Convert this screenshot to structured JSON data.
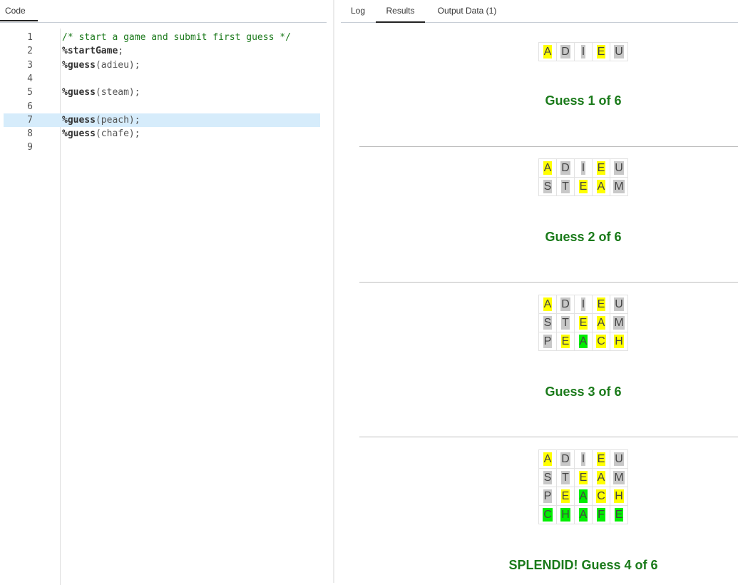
{
  "code_panel": {
    "tab_label": "Code",
    "active_line": 7,
    "lines": [
      {
        "num": "1",
        "comment": "/* start a game and submit first guess */",
        "keyword": "",
        "rest": ""
      },
      {
        "num": "2",
        "comment": "",
        "keyword": "%startGame",
        "rest": ";"
      },
      {
        "num": "3",
        "comment": "",
        "keyword": "%guess",
        "rest": "(adieu);"
      },
      {
        "num": "4",
        "comment": "",
        "keyword": "",
        "rest": ""
      },
      {
        "num": "5",
        "comment": "",
        "keyword": "%guess",
        "rest": "(steam);"
      },
      {
        "num": "6",
        "comment": "",
        "keyword": "",
        "rest": ""
      },
      {
        "num": "7",
        "comment": "",
        "keyword": "%guess",
        "rest": "(peach);"
      },
      {
        "num": "8",
        "comment": "",
        "keyword": "%guess",
        "rest": "(chafe);"
      },
      {
        "num": "9",
        "comment": "",
        "keyword": "",
        "rest": ""
      }
    ]
  },
  "results_panel": {
    "tabs": [
      {
        "label": "Log",
        "active": false
      },
      {
        "label": "Results",
        "active": true
      },
      {
        "label": "Output Data (1)",
        "active": false
      }
    ],
    "colors": {
      "present": "#ffff00",
      "absent": "#c8c8c8",
      "correct": "#00ee00",
      "title": "#1a7a1a"
    },
    "blocks": [
      {
        "title": "Guess 1 of 6",
        "rows": [
          [
            {
              "l": "A",
              "s": "present"
            },
            {
              "l": "D",
              "s": "absent"
            },
            {
              "l": "I",
              "s": "absent"
            },
            {
              "l": "E",
              "s": "present"
            },
            {
              "l": "U",
              "s": "absent"
            }
          ]
        ]
      },
      {
        "title": "Guess 2 of 6",
        "rows": [
          [
            {
              "l": "A",
              "s": "present"
            },
            {
              "l": "D",
              "s": "absent"
            },
            {
              "l": "I",
              "s": "absent"
            },
            {
              "l": "E",
              "s": "present"
            },
            {
              "l": "U",
              "s": "absent"
            }
          ],
          [
            {
              "l": "S",
              "s": "absent"
            },
            {
              "l": "T",
              "s": "absent"
            },
            {
              "l": "E",
              "s": "present"
            },
            {
              "l": "A",
              "s": "present"
            },
            {
              "l": "M",
              "s": "absent"
            }
          ]
        ]
      },
      {
        "title": "Guess 3 of 6",
        "rows": [
          [
            {
              "l": "A",
              "s": "present"
            },
            {
              "l": "D",
              "s": "absent"
            },
            {
              "l": "I",
              "s": "absent"
            },
            {
              "l": "E",
              "s": "present"
            },
            {
              "l": "U",
              "s": "absent"
            }
          ],
          [
            {
              "l": "S",
              "s": "absent"
            },
            {
              "l": "T",
              "s": "absent"
            },
            {
              "l": "E",
              "s": "present"
            },
            {
              "l": "A",
              "s": "present"
            },
            {
              "l": "M",
              "s": "absent"
            }
          ],
          [
            {
              "l": "P",
              "s": "absent"
            },
            {
              "l": "E",
              "s": "present"
            },
            {
              "l": "A",
              "s": "correct"
            },
            {
              "l": "C",
              "s": "present"
            },
            {
              "l": "H",
              "s": "present"
            }
          ]
        ]
      },
      {
        "title": "SPLENDID! Guess 4 of 6",
        "rows": [
          [
            {
              "l": "A",
              "s": "present"
            },
            {
              "l": "D",
              "s": "absent"
            },
            {
              "l": "I",
              "s": "absent"
            },
            {
              "l": "E",
              "s": "present"
            },
            {
              "l": "U",
              "s": "absent"
            }
          ],
          [
            {
              "l": "S",
              "s": "absent"
            },
            {
              "l": "T",
              "s": "absent"
            },
            {
              "l": "E",
              "s": "present"
            },
            {
              "l": "A",
              "s": "present"
            },
            {
              "l": "M",
              "s": "absent"
            }
          ],
          [
            {
              "l": "P",
              "s": "absent"
            },
            {
              "l": "E",
              "s": "present"
            },
            {
              "l": "A",
              "s": "correct"
            },
            {
              "l": "C",
              "s": "present"
            },
            {
              "l": "H",
              "s": "present"
            }
          ],
          [
            {
              "l": "C",
              "s": "correct"
            },
            {
              "l": "H",
              "s": "correct"
            },
            {
              "l": "A",
              "s": "correct"
            },
            {
              "l": "F",
              "s": "correct"
            },
            {
              "l": "E",
              "s": "correct"
            }
          ]
        ]
      }
    ]
  }
}
